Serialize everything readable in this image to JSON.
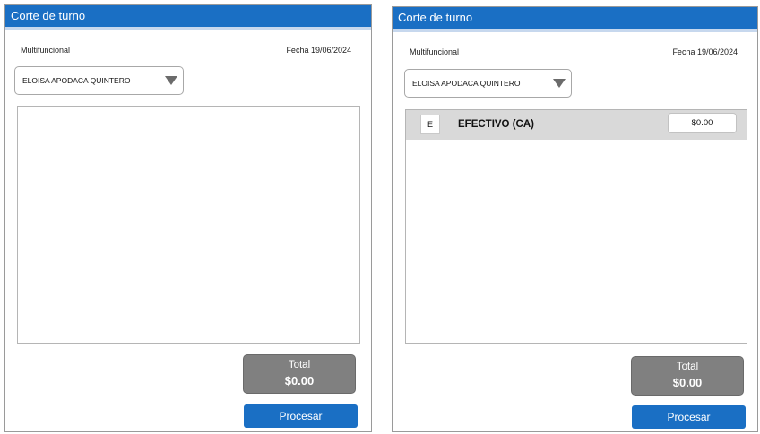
{
  "panels": [
    {
      "title": "Corte de turno",
      "subtitle": "Multifuncional",
      "date": "Fecha 19/06/2024",
      "employee": {
        "selected": "ELOISA APODACA QUINTERO"
      },
      "rows": [],
      "total": {
        "label": "Total",
        "value": "$0.00"
      },
      "process_label": "Procesar"
    },
    {
      "title": "Corte de turno",
      "subtitle": "Multifuncional",
      "date": "Fecha 19/06/2024",
      "employee": {
        "selected": "ELOISA APODACA QUINTERO"
      },
      "rows": [
        {
          "code": "E",
          "name": "EFECTIVO (CA)",
          "amount": "$0.00"
        }
      ],
      "total": {
        "label": "Total",
        "value": "$0.00"
      },
      "process_label": "Procesar"
    }
  ],
  "colors": {
    "primary": "#1a6fc4",
    "total_bg": "#808080",
    "row_bg": "#d9d9d9"
  }
}
